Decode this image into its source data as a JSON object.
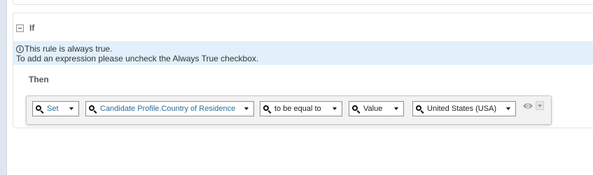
{
  "if_section": {
    "label": "If",
    "info_line1": "This rule is always true.",
    "info_line2": "To add an expression please uncheck the Always True checkbox."
  },
  "then_section": {
    "label": "Then",
    "expression": {
      "action": "Set",
      "field": "Candidate Profile.Country of Residence",
      "operator": "to be equal to",
      "value_type": "Value",
      "value": "United States (USA)"
    }
  },
  "icons": {
    "collapse": "collapse-icon",
    "info": "info-icon",
    "search": "search-icon",
    "dropdown": "chevron-down-icon",
    "visibility": "eye-icon"
  },
  "colors": {
    "info_band": "#e1f0fa",
    "link": "#2b6c9a",
    "expression_box": "#f2f2f2"
  }
}
